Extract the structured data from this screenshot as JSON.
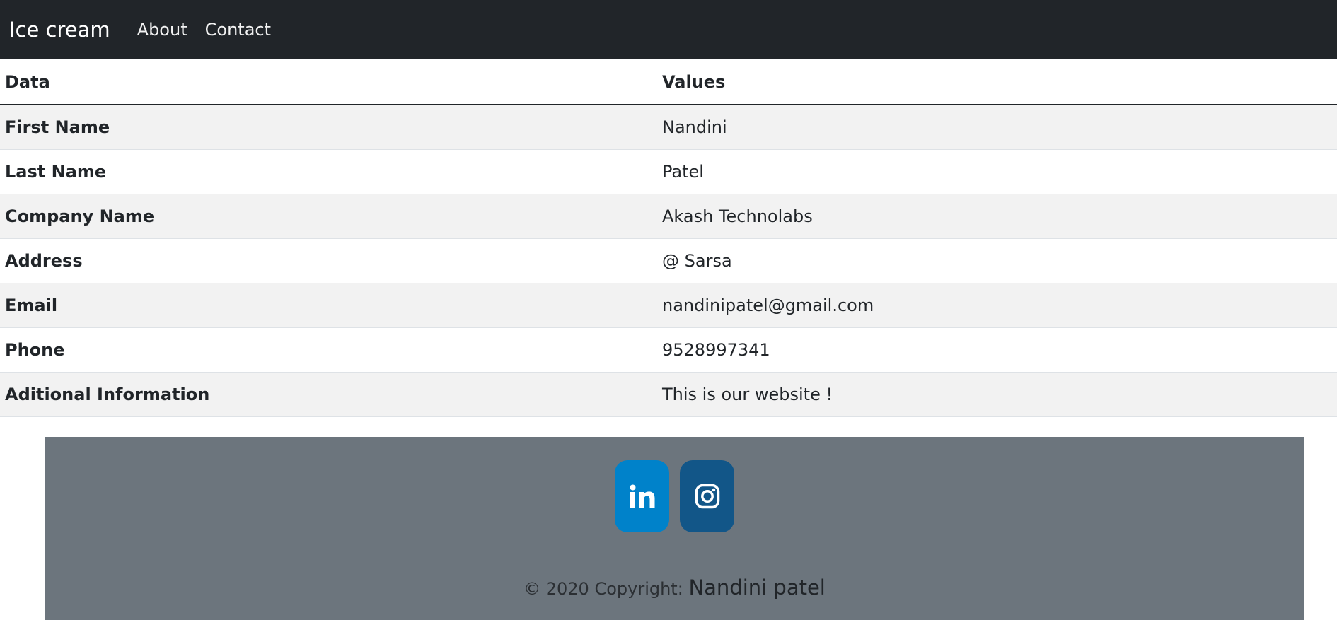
{
  "navbar": {
    "brand": "Ice cream",
    "links": [
      "About",
      "Contact"
    ]
  },
  "table": {
    "headers": [
      "Data",
      "Values"
    ],
    "rows": [
      {
        "label": "First Name",
        "value": "Nandini"
      },
      {
        "label": "Last Name",
        "value": "Patel"
      },
      {
        "label": "Company Name",
        "value": "Akash Technolabs"
      },
      {
        "label": "Address",
        "value": "@ Sarsa"
      },
      {
        "label": "Email",
        "value": "nandinipatel@gmail.com"
      },
      {
        "label": "Phone",
        "value": "9528997341"
      },
      {
        "label": "Aditional Information",
        "value": "This is our website !"
      }
    ]
  },
  "footer": {
    "social": [
      {
        "icon": "linkedin-icon",
        "color": "#0082ca"
      },
      {
        "icon": "instagram-icon",
        "color": "#125688"
      }
    ],
    "copyright_prefix": "© 2020 Copyright:",
    "copyright_owner": "Nandini patel"
  },
  "colors": {
    "navbar_bg": "#212529",
    "footer_bg": "#6c757d",
    "stripe": "#f2f2f2"
  }
}
